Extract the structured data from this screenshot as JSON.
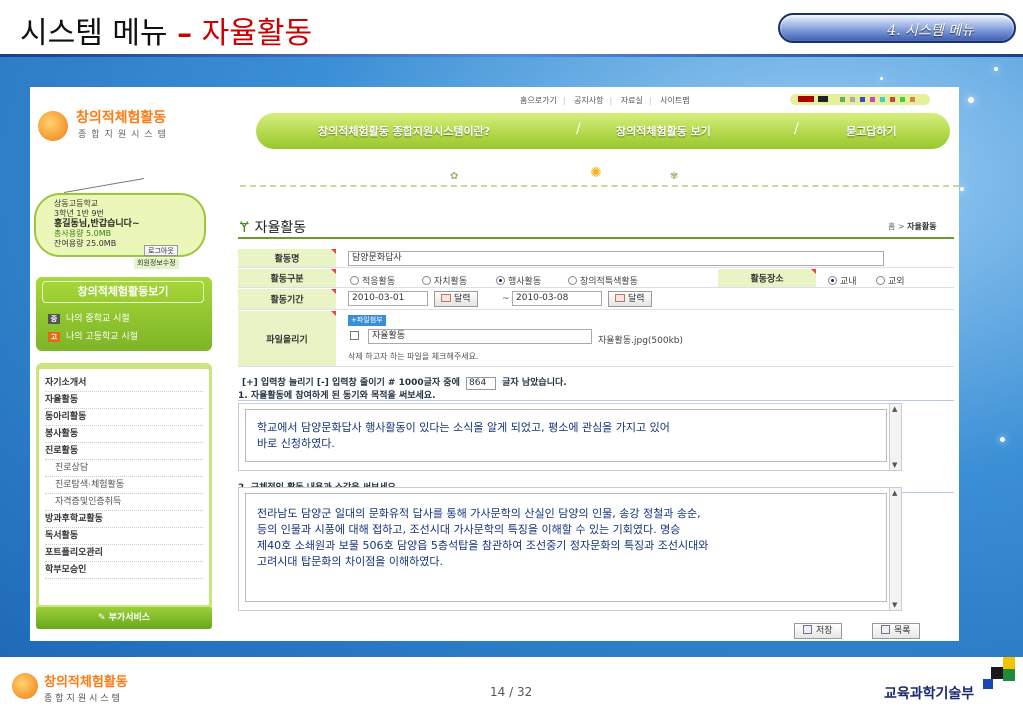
{
  "slide": {
    "title_prefix": "시스템 메뉴",
    "title_dash": "–",
    "title_accent": "자율활동",
    "badge": "4. 시스템 메뉴",
    "page_number": "14 / 32",
    "footer_logo_line1": "창의적체험활동",
    "footer_logo_line2": "종합지원시스템",
    "ministry": "교육과학기술부"
  },
  "site": {
    "logo_line1": "창의적체험활동",
    "logo_line2": "종합지원시스템",
    "top_links": [
      "홈으로가기",
      "공지사항",
      "자료실",
      "사이트맵"
    ],
    "main_nav": [
      "창의적체험활동 종합지원시스템이란?",
      "창의적체험활동 보기",
      "묻고답하기"
    ],
    "colors": {
      "accent": "#98c72a",
      "panel": "#e8f3c6",
      "link_blue": "#14337a"
    }
  },
  "profile": {
    "school": "상동고등학교",
    "class": "3학년 1반 9번",
    "greeting": "홍길동님,반갑습니다~",
    "total_quota": "총사용량 5.0MB",
    "remaining_quota": "잔여용량 25.0MB",
    "logout": "로그아웃",
    "member_edit": "회원정보수정"
  },
  "side_panel": {
    "title": "창의적체험활동보기",
    "link1_badge": "중",
    "link1": "나의 중학교 시절",
    "link2_badge": "고",
    "link2": "나의 고등학교 시절"
  },
  "side_menu": {
    "items": [
      {
        "label": "자기소개서",
        "sub": false
      },
      {
        "label": "자율활동",
        "sub": false
      },
      {
        "label": "동아리활동",
        "sub": false
      },
      {
        "label": "봉사활동",
        "sub": false
      },
      {
        "label": "진로활동",
        "sub": false
      },
      {
        "label": "진로상담",
        "sub": true
      },
      {
        "label": "진로탐색·체험활동",
        "sub": true
      },
      {
        "label": "자격증및인증취득",
        "sub": true
      },
      {
        "label": "방과후학교활동",
        "sub": false
      },
      {
        "label": "독서활동",
        "sub": false
      },
      {
        "label": "포트폴리오관리",
        "sub": false
      },
      {
        "label": "학부모승인",
        "sub": false
      }
    ],
    "extra_button": "부가서비스"
  },
  "content": {
    "page_title": "자율활동",
    "breadcrumb_home": "홈 >",
    "breadcrumb_current": "자율활동",
    "activity_name_label": "활동명",
    "activity_name_value": "담양문화답사",
    "activity_type_label": "활동구분",
    "activity_types": [
      {
        "label": "적응활동",
        "selected": false
      },
      {
        "label": "자치활동",
        "selected": false
      },
      {
        "label": "행사활동",
        "selected": true
      },
      {
        "label": "창의적특색활동",
        "selected": false
      }
    ],
    "location_label": "활동장소",
    "locations": [
      {
        "label": "교내",
        "selected": true
      },
      {
        "label": "교외",
        "selected": false
      }
    ],
    "period_label": "활동기간",
    "date_start": "2010-03-01",
    "date_sep": "~",
    "date_end": "2010-03-08",
    "calendar_button": "달력",
    "file_label": "파일올리기",
    "file_attach_badge": "+파일첨부",
    "file_input_value": "자율활동",
    "file_name": "자율활동.jpg(500kb)",
    "file_hint": "삭제 하고자 하는 파일을 체크해주세요.",
    "textarea_info_prefix": "[+] 입력창 늘리기  [-] 입력창 줄이기   # 1000글자 중에",
    "char_count": "864",
    "textarea_info_suffix": "글자 남았습니다.",
    "question1": "1. 자율활동에 참여하게 된 동기와 목적을 써보세요.",
    "answer1_line1": "학교에서 담양문화답사 행사활동이 있다는 소식을 알게 되었고, 평소에 관심을 가지고 있어",
    "answer1_line2": "바로 신청하였다.",
    "question2": "2. 구체적인 활동 내용과 소감을 써보세요.",
    "answer2_line1": "전라남도 담양군 일대의 문화유적 답사를 통해 가사문학의 산실인 담양의 인물, 송강 정철과 송순,",
    "answer2_line2": "등의 인물과 시풍에 대해 접하고, 조선시대 가사문학의 특징을 이해할 수 있는 기회였다. 명승",
    "answer2_line3": "제40호 소쇄원과 보물 506호 담양읍 5층석탑을 참관하여 조선중기 정자문화의 특징과 조선시대와",
    "answer2_line4": "고려시대 탑문화의 차이점을 이해하였다.",
    "save_button": "저장",
    "list_button": "목록"
  }
}
